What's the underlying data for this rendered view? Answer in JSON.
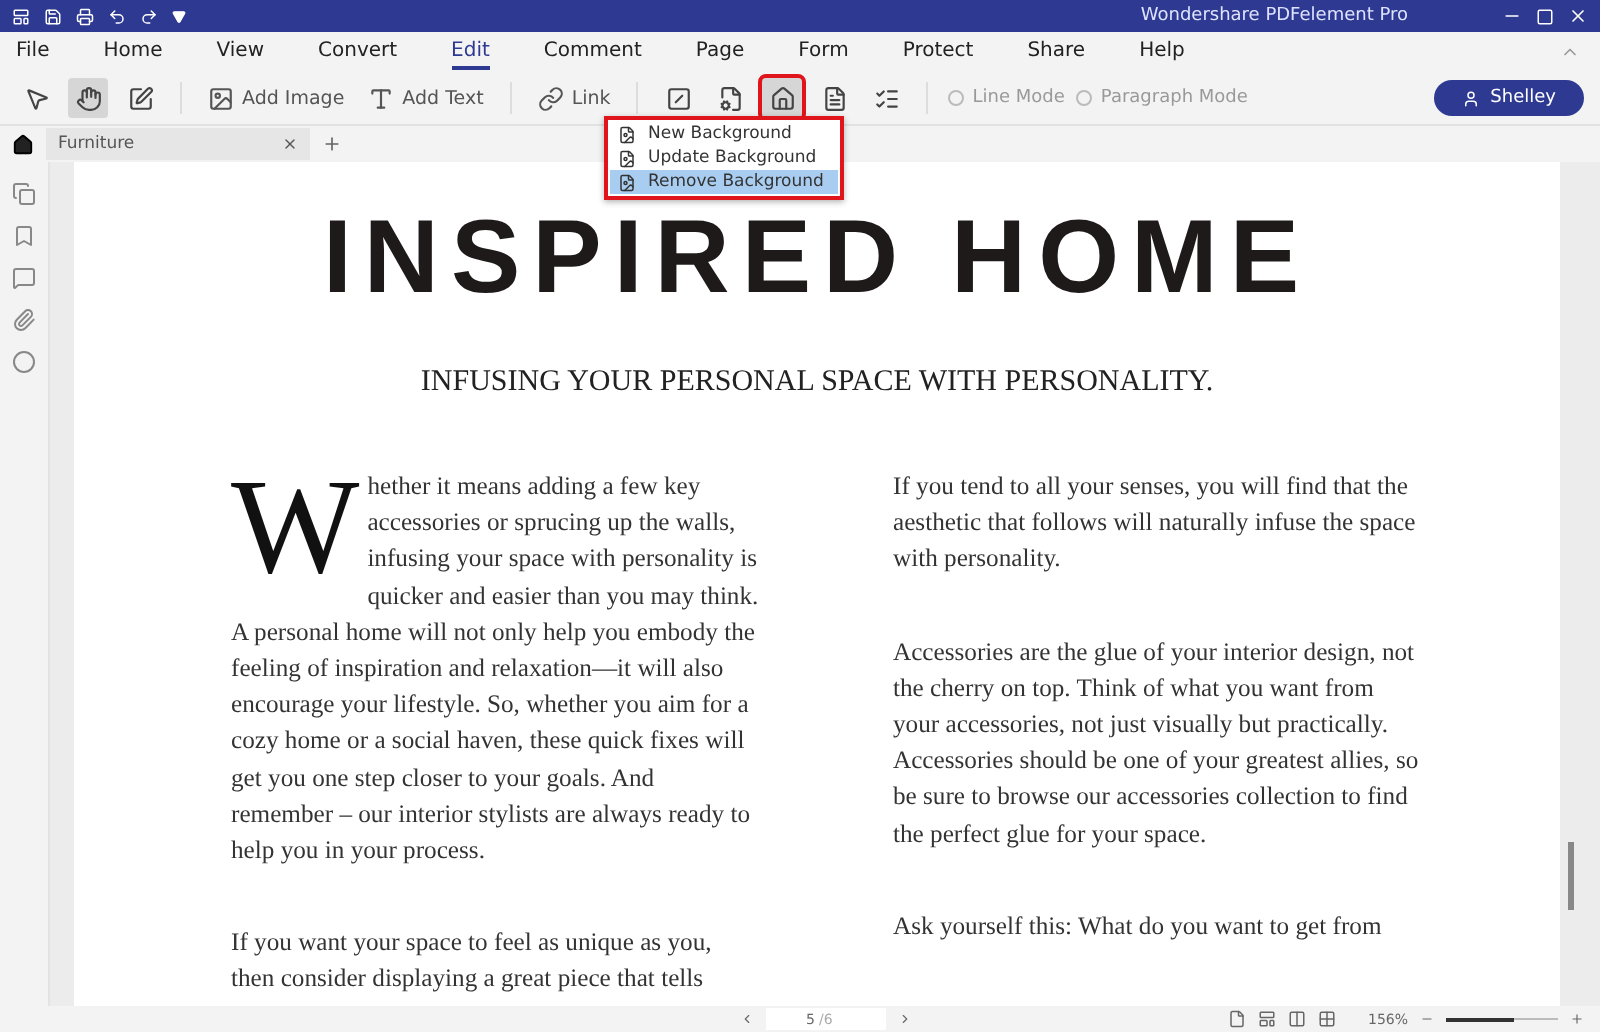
{
  "window": {
    "title": "Wondershare PDFelement Pro"
  },
  "menu": [
    {
      "label": "File",
      "selected": false
    },
    {
      "label": "Home",
      "selected": false
    },
    {
      "label": "View",
      "selected": false
    },
    {
      "label": "Convert",
      "selected": false
    },
    {
      "label": "Edit",
      "selected": true
    },
    {
      "label": "Comment",
      "selected": false
    },
    {
      "label": "Page",
      "selected": false
    },
    {
      "label": "Form",
      "selected": false
    },
    {
      "label": "Protect",
      "selected": false
    },
    {
      "label": "Share",
      "selected": false
    },
    {
      "label": "Help",
      "selected": false
    }
  ],
  "toolbar": {
    "tools": [
      {
        "selected": false
      },
      {
        "selected": true
      },
      {
        "selected": false
      }
    ],
    "buttons": [
      {
        "label": "Add Image"
      },
      {
        "label": "Add Text"
      },
      {
        "label": "Link"
      }
    ],
    "object_tools": [
      {
        "selected": false
      },
      {
        "selected": false
      },
      {
        "selected": true
      },
      {
        "selected": false
      },
      {
        "selected": false
      }
    ],
    "modes": [
      {
        "label": "Line Mode",
        "selected": false
      },
      {
        "label": "Paragraph Mode",
        "selected": false
      }
    ],
    "user": "Shelley"
  },
  "background_menu": [
    {
      "label": "New Background",
      "selected": false
    },
    {
      "label": "Update Background",
      "selected": false
    },
    {
      "label": "Remove Background",
      "selected": true
    }
  ],
  "tabs": [
    {
      "label": "Furniture",
      "selected": true
    }
  ],
  "document": {
    "title": "INSPIRED HOME",
    "subtitle": "INFUSING YOUR PERSONAL SPACE WITH PERSONALITY.",
    "columns": [
      [
        {
          "drop_cap": "W",
          "text": "hether it means adding a few key accessories or sprucing up the walls, infusing your space with personality is quicker and easier than you may think. A personal home will not only help you embody the feeling of inspiration and relaxation—it will also encourage your lifestyle. So, whether you aim for a cozy home or a social haven, these quick fixes will get you one step closer to your goals. And remember – our interior stylists are always ready to help you in your process."
        },
        {
          "text": "If you want your space to feel as unique as you, then consider displaying a great piece that tells"
        }
      ],
      [
        {
          "text": "If you tend to all your senses, you will find that the aesthetic that follows will naturally infuse the space with personality."
        },
        {
          "text": "Accessories are the glue of your interior design, not the cherry on top. Think of what you want from your accessories, not just visually but practically. Accessories should be one of your greatest allies, so be sure to browse our accessories collection to find the perfect glue for your space."
        },
        {
          "text": "Ask yourself this: What do you want to get from"
        }
      ]
    ]
  },
  "status_bar": {
    "page": "5",
    "page_total": "/6",
    "zoom": "156%",
    "zoom_slider": {
      "level": 0.6
    }
  }
}
